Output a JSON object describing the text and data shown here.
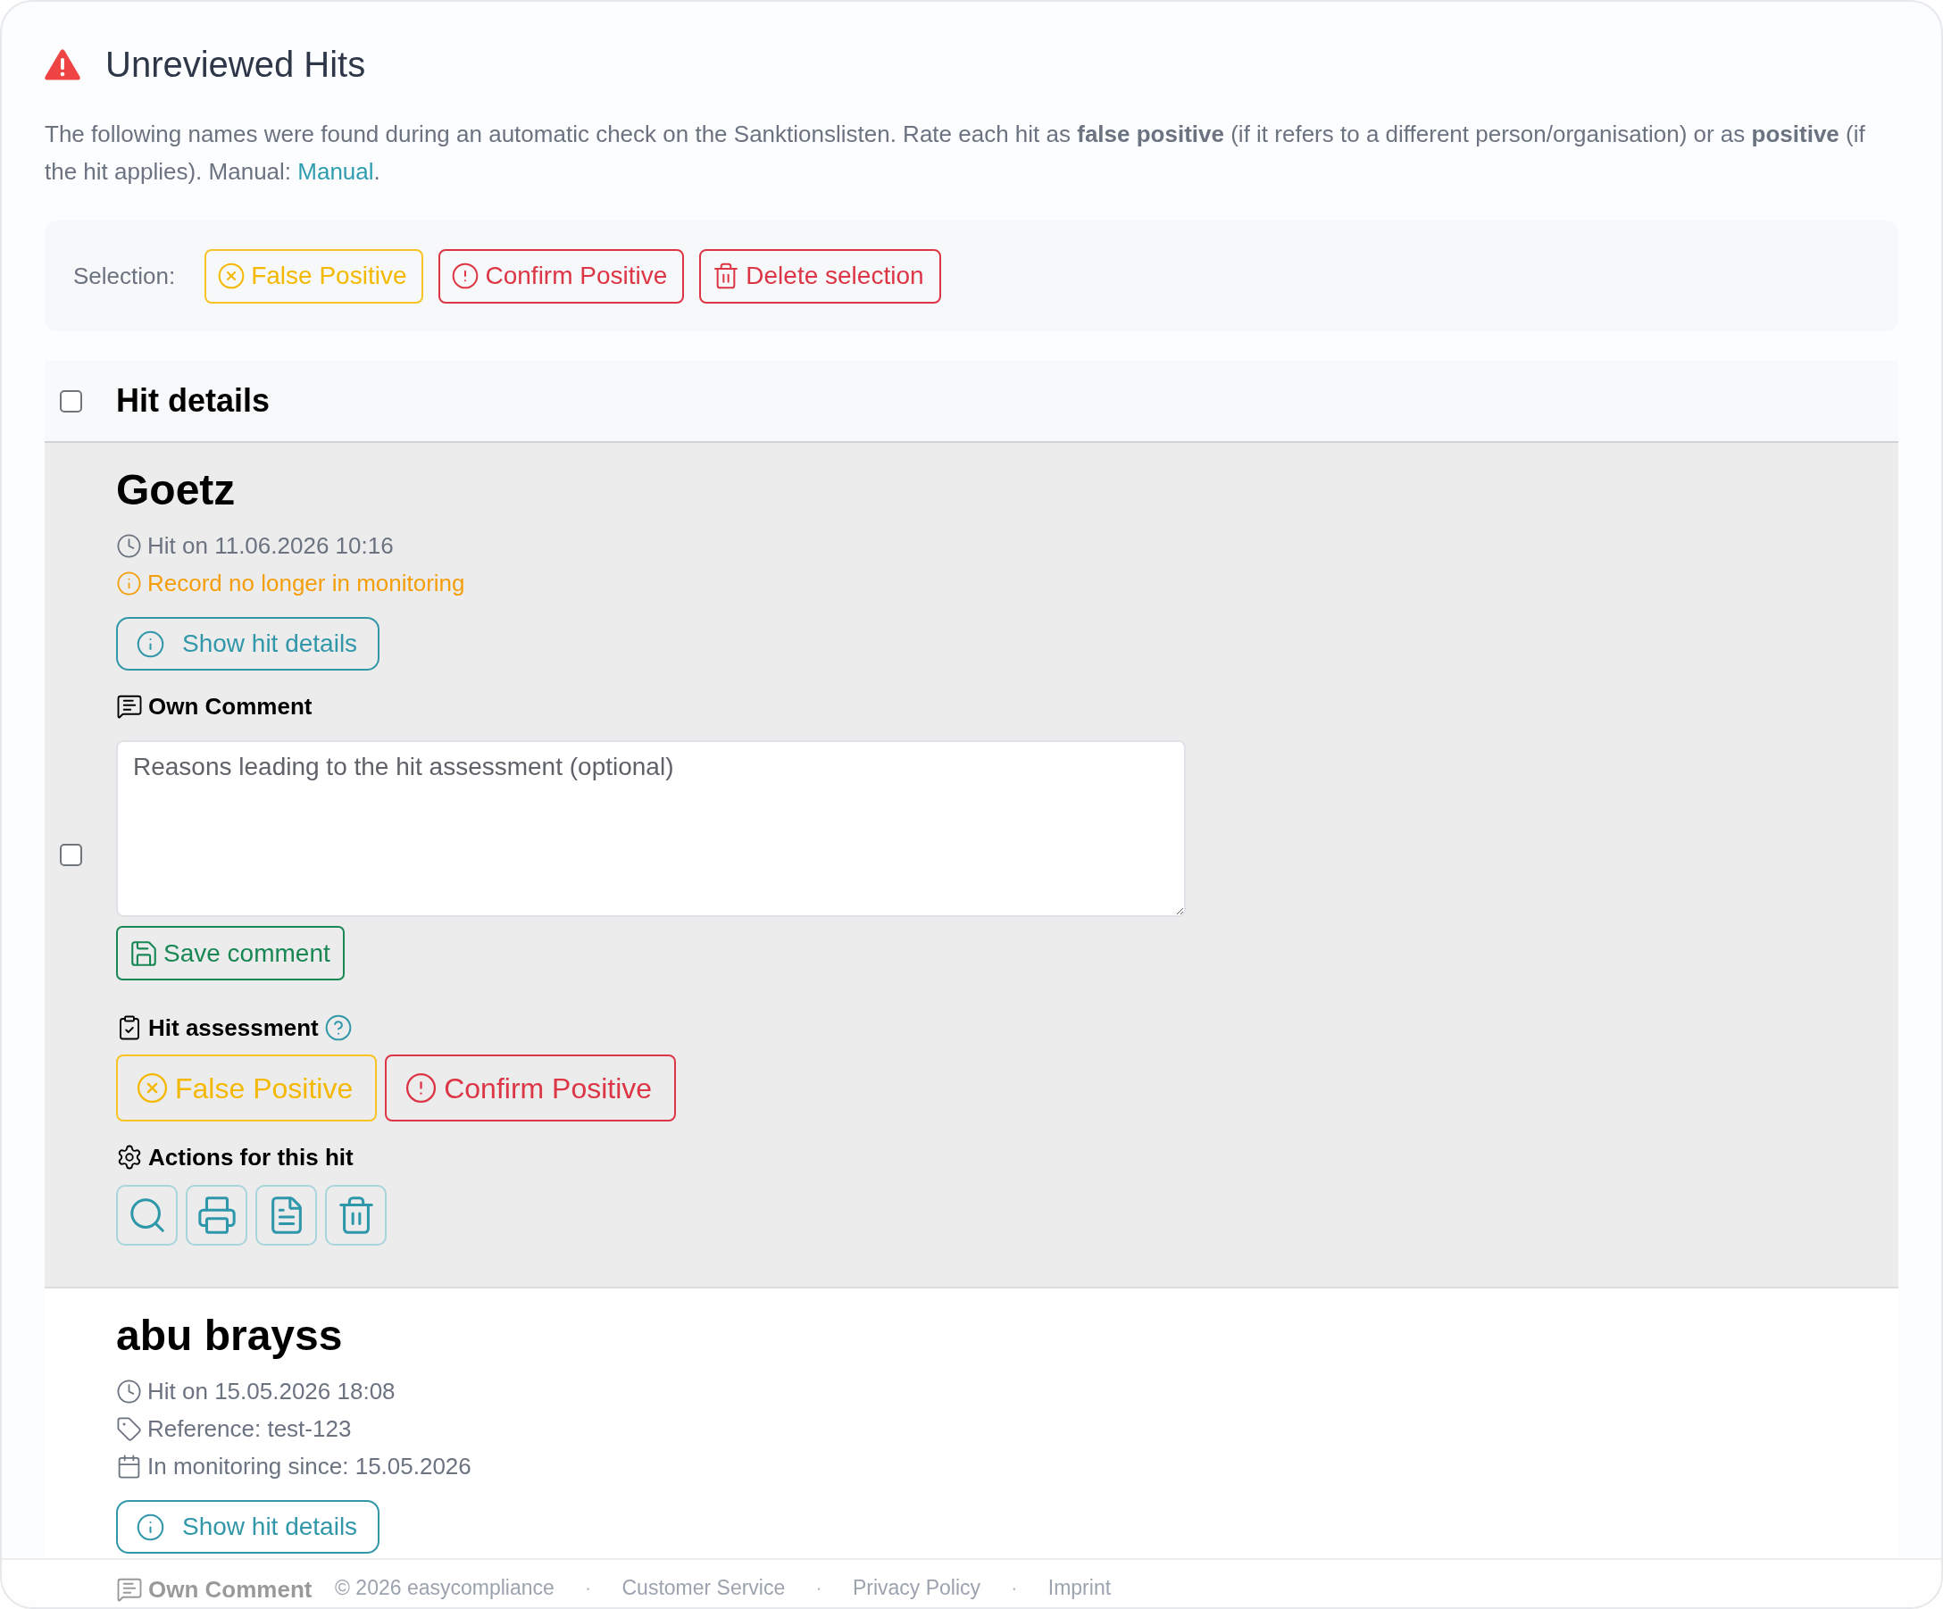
{
  "header": {
    "title": "Unreviewed Hits",
    "intro": {
      "text": "The following names were found during an automatic check on the Sanktionslisten. Rate each hit as **false positive** (if it refers to a different person/organisation) or as **positive** (if the hit applies). Manual:",
      "link": "Manual",
      "after": "."
    }
  },
  "selection_bar": {
    "label": "Selection:",
    "buttons": [
      {
        "kind": "false_positive",
        "label": "False Positive"
      },
      {
        "kind": "confirm_positive",
        "label": "Confirm Positive"
      },
      {
        "kind": "delete",
        "label": "Delete selection"
      }
    ]
  },
  "list_header": {
    "checked": false,
    "title": "Hit details"
  },
  "hits": [
    {
      "name": "Goetz",
      "highlighted": true,
      "checked": false,
      "meta": [
        {
          "kind": "time",
          "text": "Hit on 11.06.2026 10:16"
        },
        {
          "kind": "warning",
          "text": "Record no longer in monitoring"
        }
      ],
      "details_button": "Show hit details",
      "comment": {
        "label": "Own Comment",
        "placeholder": "Reasons leading to the hit assessment (optional)",
        "save_button": "Save comment"
      },
      "assessment": {
        "label": "Hit assessment",
        "buttons": [
          {
            "kind": "false_positive",
            "label": "False Positive"
          },
          {
            "kind": "confirm_positive",
            "label": "Confirm Positive"
          }
        ]
      },
      "actions": {
        "label": "Actions for this hit",
        "buttons": [
          {
            "kind": "search"
          },
          {
            "kind": "print"
          },
          {
            "kind": "pdf"
          },
          {
            "kind": "delete"
          }
        ]
      }
    },
    {
      "name": "abu brayss",
      "highlighted": false,
      "meta": [
        {
          "kind": "time",
          "text": "Hit on 15.05.2026 18:08"
        },
        {
          "kind": "reference",
          "text": "Reference: test-123"
        },
        {
          "kind": "monitoring",
          "text": "In monitoring since: 15.05.2026"
        }
      ],
      "details_button": "Show hit details",
      "comment": {
        "label": "Own Comment"
      }
    }
  ],
  "footer": {
    "items": [
      {
        "kind": "text",
        "text": "© 2026 easycompliance"
      },
      {
        "kind": "separator",
        "text": "·"
      },
      {
        "kind": "link",
        "text": "Customer Service"
      },
      {
        "kind": "separator",
        "text": "·"
      },
      {
        "kind": "link",
        "text": "Privacy Policy"
      },
      {
        "kind": "separator",
        "text": "·"
      },
      {
        "kind": "link",
        "text": "Imprint"
      }
    ]
  }
}
